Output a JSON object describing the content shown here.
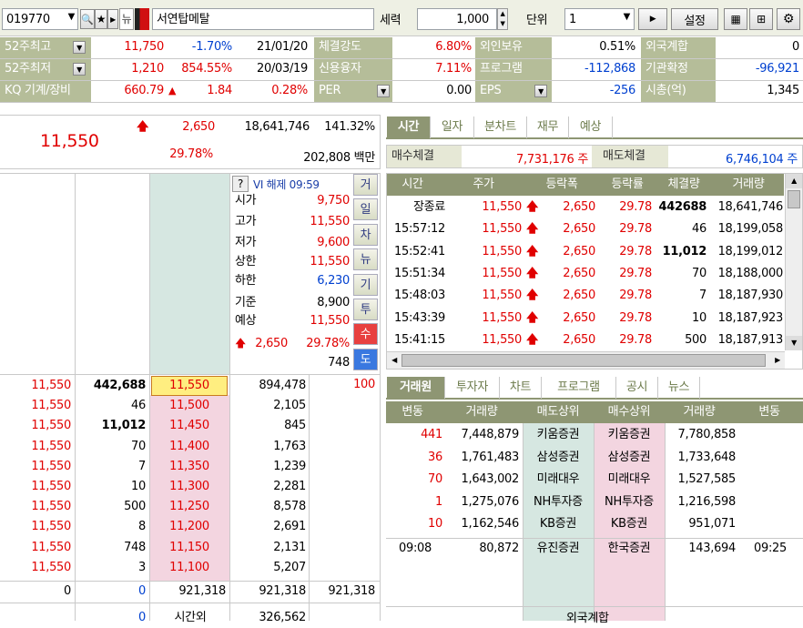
{
  "toolbar": {
    "code": "019770",
    "news_badge": "뉴",
    "name": "서연탑메탈",
    "power_label": "세력",
    "power_value": "1,000",
    "unit_label": "단위",
    "unit_value": "1",
    "settings_label": "설정"
  },
  "info": {
    "rows": [
      {
        "l1": "52주최고",
        "v1": "11,750",
        "v2": "-1.70%",
        "v3": "21/01/20",
        "l2": "체결강도",
        "v4": "6.80%",
        "l3": "외인보유",
        "v5": "0.51%",
        "l4": "외국계합",
        "v6": "0"
      },
      {
        "l1": "52주최저",
        "v1": "1,210",
        "v2": "854.55%",
        "v3": "20/03/19",
        "l2": "신용융자",
        "v4": "7.11%",
        "l3": "프로그램",
        "v5": "-112,868",
        "l4": "기관확정",
        "v6": "-96,921"
      },
      {
        "l1": "KQ 기계/장비",
        "v1": "660.79",
        "arrow": "▲",
        "v2": "1.84",
        "v3": "0.28%",
        "l2": "PER",
        "v4": "0.00",
        "l3": "EPS",
        "v5": "-256",
        "l4": "시총(억)",
        "v6": "1,345"
      }
    ]
  },
  "price": {
    "current": "11,550",
    "change": "2,650",
    "volume": "18,641,746",
    "ratio": "141.32%",
    "rate": "29.78%",
    "amount": "202,808 백만"
  },
  "vi": {
    "q": "?",
    "text": "VI 해제 09:59"
  },
  "quote_info": [
    {
      "label": "시가",
      "value": "9,750"
    },
    {
      "label": "고가",
      "value": "11,550"
    },
    {
      "label": "저가",
      "value": "9,600"
    },
    {
      "label": "상한",
      "value": "11,550"
    },
    {
      "label": "하한",
      "value": "6,230"
    },
    {
      "label": "기준",
      "value": "8,900"
    },
    {
      "label": "예상",
      "value": "11,550"
    }
  ],
  "expected": {
    "change": "2,650",
    "rate": "29.78%",
    "qty": "748"
  },
  "side_buttons": [
    "거",
    "일",
    "차",
    "뉴",
    "기",
    "투",
    "수",
    "도"
  ],
  "ask_top_qty": "100",
  "bids": [
    {
      "tick_price": "11,550",
      "tick_qty": "442,688",
      "price": "11,550",
      "qty": "894,478"
    },
    {
      "tick_price": "11,550",
      "tick_qty": "46",
      "price": "11,500",
      "qty": "2,105"
    },
    {
      "tick_price": "11,550",
      "tick_qty": "11,012",
      "price": "11,450",
      "qty": "845"
    },
    {
      "tick_price": "11,550",
      "tick_qty": "70",
      "price": "11,400",
      "qty": "1,763"
    },
    {
      "tick_price": "11,550",
      "tick_qty": "7",
      "price": "11,350",
      "qty": "1,239"
    },
    {
      "tick_price": "11,550",
      "tick_qty": "10",
      "price": "11,300",
      "qty": "2,281"
    },
    {
      "tick_price": "11,550",
      "tick_qty": "500",
      "price": "11,250",
      "qty": "8,578"
    },
    {
      "tick_price": "11,550",
      "tick_qty": "8",
      "price": "11,200",
      "qty": "2,691"
    },
    {
      "tick_price": "11,550",
      "tick_qty": "748",
      "price": "11,150",
      "qty": "2,131"
    },
    {
      "tick_price": "11,550",
      "tick_qty": "3",
      "price": "11,100",
      "qty": "5,207"
    }
  ],
  "totals": {
    "a": "0",
    "b": "0",
    "c": "921,318",
    "d": "921,318",
    "e": "921,318"
  },
  "bottom": {
    "a": "0",
    "label": "시간외",
    "value": "326,562"
  },
  "tabs1": [
    "시간",
    "일자",
    "분차트",
    "재무",
    "예상"
  ],
  "exec": {
    "buy_label": "매수체결",
    "buy_value": "7,731,176 주",
    "sell_label": "매도체결",
    "sell_value": "6,746,104 주"
  },
  "trade_headers": [
    "시간",
    "주가",
    "등락폭",
    "등락률",
    "체결량",
    "거래량"
  ],
  "trades": [
    {
      "time": "장종료",
      "price": "11,550",
      "chg": "2,650",
      "rate": "29.78",
      "qty": "442688",
      "vol": "18,641,746",
      "bold": true
    },
    {
      "time": "15:57:12",
      "price": "11,550",
      "chg": "2,650",
      "rate": "29.78",
      "qty": "46",
      "vol": "18,199,058"
    },
    {
      "time": "15:52:41",
      "price": "11,550",
      "chg": "2,650",
      "rate": "29.78",
      "qty": "11,012",
      "vol": "18,199,012",
      "bold": true
    },
    {
      "time": "15:51:34",
      "price": "11,550",
      "chg": "2,650",
      "rate": "29.78",
      "qty": "70",
      "vol": "18,188,000"
    },
    {
      "time": "15:48:03",
      "price": "11,550",
      "chg": "2,650",
      "rate": "29.78",
      "qty": "7",
      "vol": "18,187,930"
    },
    {
      "time": "15:43:39",
      "price": "11,550",
      "chg": "2,650",
      "rate": "29.78",
      "qty": "10",
      "vol": "18,187,923"
    },
    {
      "time": "15:41:15",
      "price": "11,550",
      "chg": "2,650",
      "rate": "29.78",
      "qty": "500",
      "vol": "18,187,913"
    }
  ],
  "tabs2": [
    "거래원",
    "투자자",
    "차트",
    "프로그램",
    "공시",
    "뉴스"
  ],
  "broker_headers": [
    "변동",
    "거래량",
    "매도상위",
    "매수상위",
    "거래량",
    "변동"
  ],
  "brokers": [
    {
      "d1": "441",
      "v1": "7,448,879",
      "sell": "키움증권",
      "buy": "키움증권",
      "v2": "7,780,858",
      "d2": ""
    },
    {
      "d1": "36",
      "v1": "1,761,483",
      "sell": "삼성증권",
      "buy": "삼성증권",
      "v2": "1,733,648",
      "d2": ""
    },
    {
      "d1": "70",
      "v1": "1,643,002",
      "sell": "미래대우",
      "buy": "미래대우",
      "v2": "1,527,585",
      "d2": ""
    },
    {
      "d1": "1",
      "v1": "1,275,076",
      "sell": "NH투자증",
      "buy": "NH투자증",
      "v2": "1,216,598",
      "d2": ""
    },
    {
      "d1": "10",
      "v1": "1,162,546",
      "sell": "KB증권",
      "buy": "KB증권",
      "v2": "951,071",
      "d2": ""
    }
  ],
  "broker_extra": {
    "t1": "09:08",
    "v1": "80,872",
    "sell": "유진증권",
    "buy": "한국증권",
    "v2": "143,694",
    "t2": "09:25"
  },
  "foreign_label": "외국계합"
}
